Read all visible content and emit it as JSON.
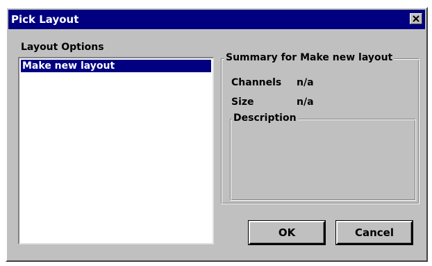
{
  "window": {
    "title": "Pick Layout",
    "close_icon": "close-x-icon"
  },
  "layout_options": {
    "label": "Layout Options",
    "items": [
      {
        "label": "Make new layout",
        "selected": true
      }
    ]
  },
  "summary": {
    "title": "Summary for Make new layout",
    "channels_label": "Channels",
    "channels_value": "n/a",
    "size_label": "Size",
    "size_value": "n/a",
    "description_label": "Description",
    "description_value": ""
  },
  "buttons": {
    "ok_label": "OK",
    "cancel_label": "Cancel"
  },
  "colors": {
    "title_bar": "#000080",
    "dialog_face": "#c0c0c0",
    "selection": "#000080"
  }
}
